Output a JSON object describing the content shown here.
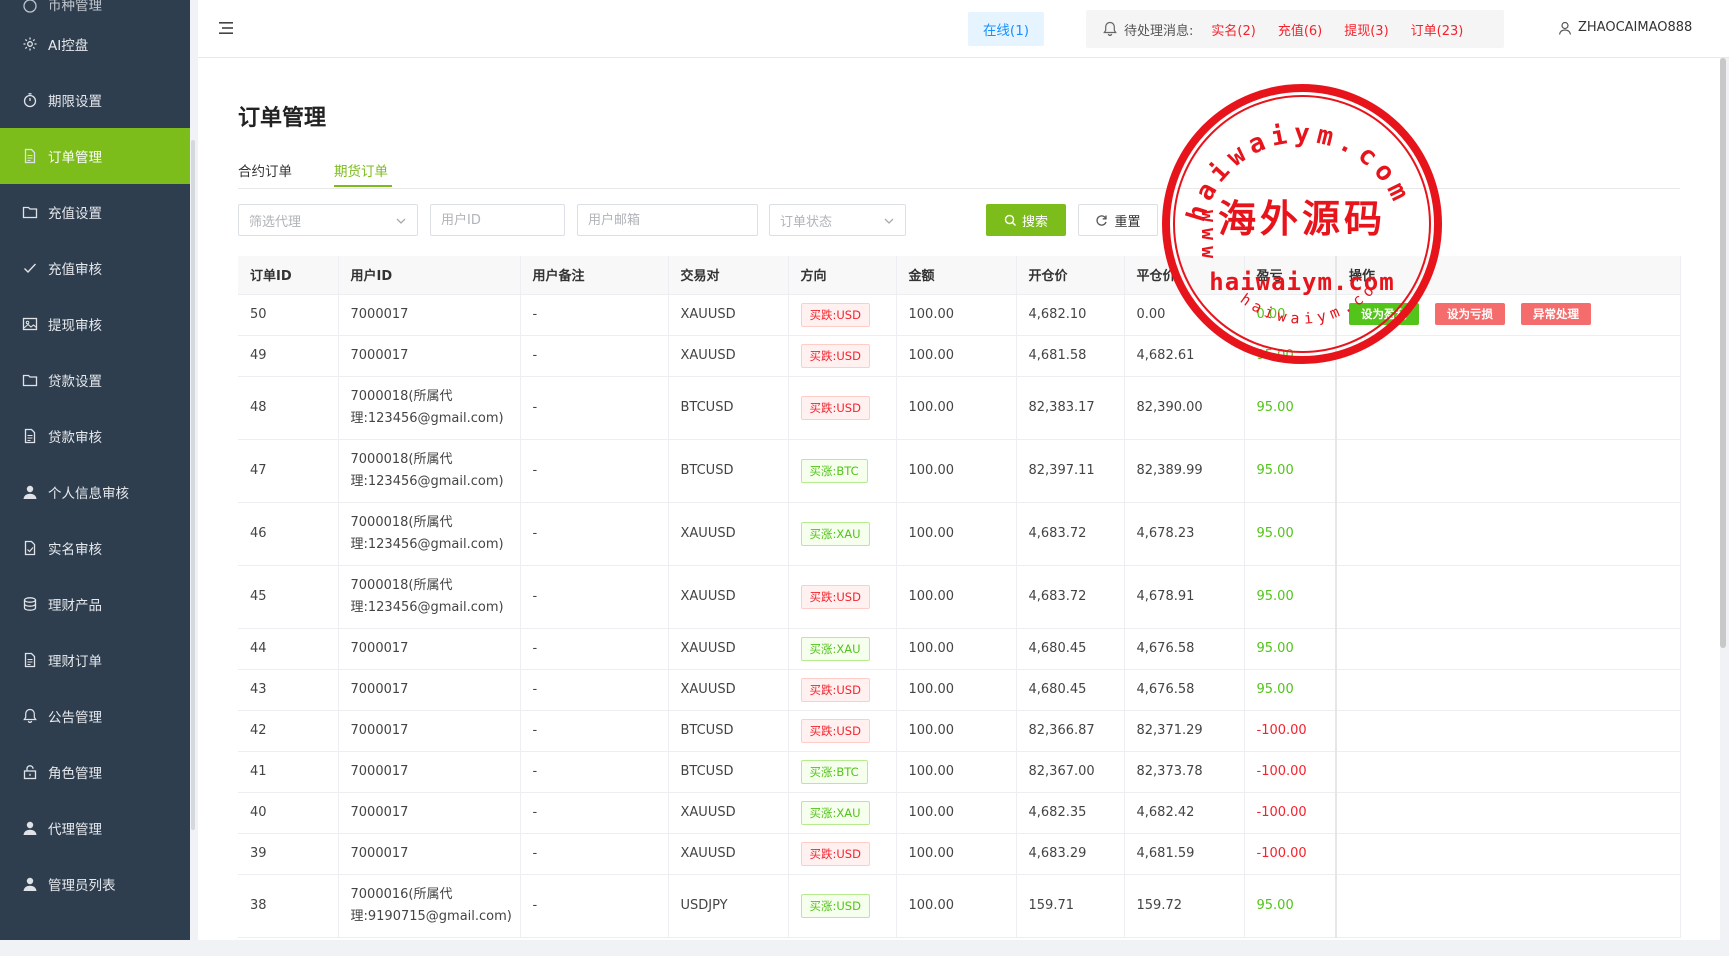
{
  "sidebar": {
    "items": [
      {
        "label": "币种管理",
        "icon": "coin-icon"
      },
      {
        "label": "AI控盘",
        "icon": "gear-icon"
      },
      {
        "label": "期限设置",
        "icon": "timer-icon"
      },
      {
        "label": "订单管理",
        "icon": "document-icon",
        "active": true
      },
      {
        "label": "充值设置",
        "icon": "folder-icon"
      },
      {
        "label": "充值审核",
        "icon": "check-icon"
      },
      {
        "label": "提现审核",
        "icon": "image-icon"
      },
      {
        "label": "贷款设置",
        "icon": "folder-icon"
      },
      {
        "label": "贷款审核",
        "icon": "document-icon"
      },
      {
        "label": "个人信息审核",
        "icon": "user-icon"
      },
      {
        "label": "实名审核",
        "icon": "doc-check-icon"
      },
      {
        "label": "理财产品",
        "icon": "database-icon"
      },
      {
        "label": "理财订单",
        "icon": "document-icon"
      },
      {
        "label": "公告管理",
        "icon": "bell-icon"
      },
      {
        "label": "角色管理",
        "icon": "lock-icon"
      },
      {
        "label": "代理管理",
        "icon": "user-icon"
      },
      {
        "label": "管理员列表",
        "icon": "user-icon"
      }
    ]
  },
  "header": {
    "online": "在线(1)",
    "pending_label": "待处理消息:",
    "pending": [
      {
        "label": "实名(2)"
      },
      {
        "label": "充值(6)"
      },
      {
        "label": "提现(3)"
      },
      {
        "label": "订单(23)"
      }
    ],
    "username": "ZHAOCAIMAO888"
  },
  "page": {
    "title": "订单管理",
    "tabs": [
      "合约订单",
      "期货订单"
    ],
    "active_tab": 1
  },
  "filters": {
    "agent_placeholder": "筛选代理",
    "user_id_placeholder": "用户ID",
    "email_placeholder": "用户邮箱",
    "status_placeholder": "订单状态",
    "search_label": "搜索",
    "reset_label": "重置"
  },
  "table": {
    "columns": [
      "订单ID",
      "用户ID",
      "用户备注",
      "交易对",
      "方向",
      "金额",
      "开仓价",
      "平仓价",
      "盈亏",
      "操作"
    ],
    "rows": [
      {
        "id": "50",
        "user": "7000017",
        "note": "-",
        "pair": "XAUUSD",
        "dir": "买跌:USD",
        "dir_type": "down",
        "amount": "100.00",
        "open": "4,682.10",
        "close": "0.00",
        "pnl": "0.00",
        "pnl_type": "pos",
        "actions": [
          "设为盈利",
          "设为亏损",
          "异常处理"
        ]
      },
      {
        "id": "49",
        "user": "7000017",
        "note": "-",
        "pair": "XAUUSD",
        "dir": "买跌:USD",
        "dir_type": "down",
        "amount": "100.00",
        "open": "4,681.58",
        "close": "4,682.61",
        "pnl": "95.00",
        "pnl_type": "pos"
      },
      {
        "id": "48",
        "user": "7000018(所属代理:123456@gmail.com)",
        "note": "-",
        "pair": "BTCUSD",
        "dir": "买跌:USD",
        "dir_type": "down",
        "amount": "100.00",
        "open": "82,383.17",
        "close": "82,390.00",
        "pnl": "95.00",
        "pnl_type": "pos"
      },
      {
        "id": "47",
        "user": "7000018(所属代理:123456@gmail.com)",
        "note": "-",
        "pair": "BTCUSD",
        "dir": "买涨:BTC",
        "dir_type": "up",
        "amount": "100.00",
        "open": "82,397.11",
        "close": "82,389.99",
        "pnl": "95.00",
        "pnl_type": "pos"
      },
      {
        "id": "46",
        "user": "7000018(所属代理:123456@gmail.com)",
        "note": "-",
        "pair": "XAUUSD",
        "dir": "买涨:XAU",
        "dir_type": "up",
        "amount": "100.00",
        "open": "4,683.72",
        "close": "4,678.23",
        "pnl": "95.00",
        "pnl_type": "pos"
      },
      {
        "id": "45",
        "user": "7000018(所属代理:123456@gmail.com)",
        "note": "-",
        "pair": "XAUUSD",
        "dir": "买跌:USD",
        "dir_type": "down",
        "amount": "100.00",
        "open": "4,683.72",
        "close": "4,678.91",
        "pnl": "95.00",
        "pnl_type": "pos"
      },
      {
        "id": "44",
        "user": "7000017",
        "note": "-",
        "pair": "XAUUSD",
        "dir": "买涨:XAU",
        "dir_type": "up",
        "amount": "100.00",
        "open": "4,680.45",
        "close": "4,676.58",
        "pnl": "95.00",
        "pnl_type": "pos"
      },
      {
        "id": "43",
        "user": "7000017",
        "note": "-",
        "pair": "XAUUSD",
        "dir": "买跌:USD",
        "dir_type": "down",
        "amount": "100.00",
        "open": "4,680.45",
        "close": "4,676.58",
        "pnl": "95.00",
        "pnl_type": "pos"
      },
      {
        "id": "42",
        "user": "7000017",
        "note": "-",
        "pair": "BTCUSD",
        "dir": "买跌:USD",
        "dir_type": "down",
        "amount": "100.00",
        "open": "82,366.87",
        "close": "82,371.29",
        "pnl": "-100.00",
        "pnl_type": "neg"
      },
      {
        "id": "41",
        "user": "7000017",
        "note": "-",
        "pair": "BTCUSD",
        "dir": "买涨:BTC",
        "dir_type": "up",
        "amount": "100.00",
        "open": "82,367.00",
        "close": "82,373.78",
        "pnl": "-100.00",
        "pnl_type": "neg"
      },
      {
        "id": "40",
        "user": "7000017",
        "note": "-",
        "pair": "XAUUSD",
        "dir": "买涨:XAU",
        "dir_type": "up",
        "amount": "100.00",
        "open": "4,682.35",
        "close": "4,682.42",
        "pnl": "-100.00",
        "pnl_type": "neg"
      },
      {
        "id": "39",
        "user": "7000017",
        "note": "-",
        "pair": "XAUUSD",
        "dir": "买跌:USD",
        "dir_type": "down",
        "amount": "100.00",
        "open": "4,683.29",
        "close": "4,681.59",
        "pnl": "-100.00",
        "pnl_type": "neg"
      },
      {
        "id": "38",
        "user": "7000016(所属代理:9190715@gmail.com)",
        "note": "-",
        "pair": "USDJPY",
        "dir": "买涨:USD",
        "dir_type": "up",
        "amount": "100.00",
        "open": "159.71",
        "close": "159.72",
        "pnl": "95.00",
        "pnl_type": "pos"
      }
    ]
  },
  "watermark": {
    "top_arc": "haiwaiym.com",
    "left_arc": "www",
    "center": "海外源码",
    "url": "haiwaiym.com",
    "bottom_arc": "haiwaiym.com"
  },
  "colors": {
    "sidebar_bg": "#2f3e4e",
    "accent": "#7cbd1c",
    "danger": "#f5222d",
    "success": "#52c41a",
    "seal_red": "#e8141c"
  }
}
